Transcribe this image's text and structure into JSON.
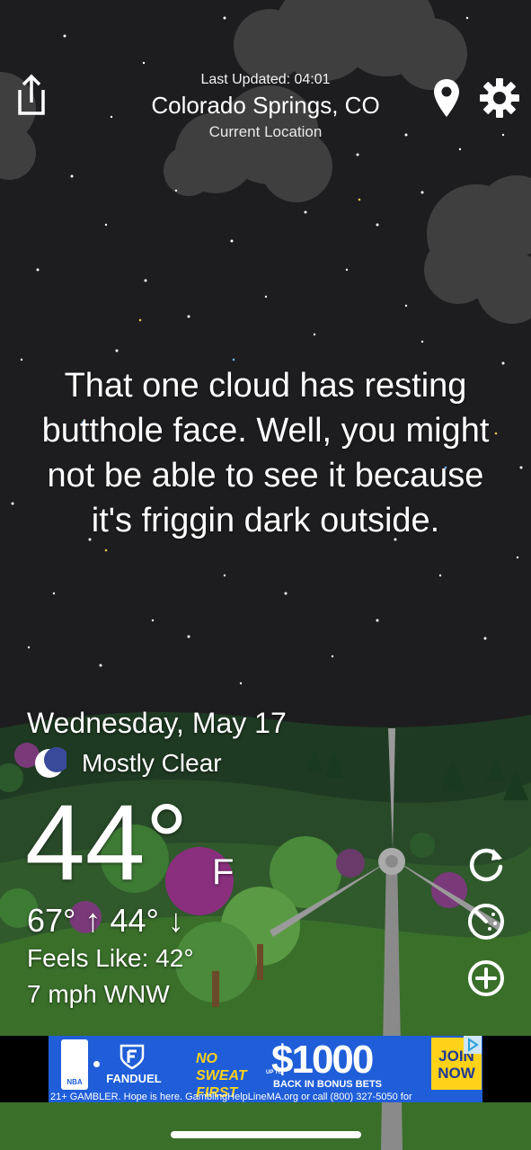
{
  "header": {
    "last_updated": "Last Updated: 04:01",
    "city": "Colorado Springs, CO",
    "subtitle": "Current Location"
  },
  "icons": {
    "share": "share-icon",
    "location": "location-pin-icon",
    "settings": "gear-icon",
    "condition": "crescent-moon-icon",
    "refresh": "refresh-icon",
    "radar": "radar-icon",
    "add": "add-circle-icon"
  },
  "message": "That one cloud has resting butthole face. Well, you might not be able to see it because it's friggin dark outside.",
  "weather": {
    "date": "Wednesday, May 17",
    "condition": "Mostly Clear",
    "temperature": "44°",
    "unit": "F",
    "high_low": "67° ↑  44° ↓",
    "feels_like": "Feels Like: 42°",
    "wind": "7 mph WNW"
  },
  "ad": {
    "nba": "NBA",
    "brand": "FANDUEL",
    "headline": "NO SWEAT FIRST BET",
    "up_to": "UP TO",
    "amount": "$1000",
    "bonus": "BACK IN BONUS BETS",
    "cta": "JOIN NOW",
    "disclaimer": "21+ GAMBLER. Hope is here. GamblingHelpLineMA.org or call (800) 327-5050 for"
  },
  "colors": {
    "night_sky": "#1d1d1f",
    "hill_green": "#3a6f2a",
    "ad_blue": "#1f5ed8",
    "ad_yellow": "#ffd21a"
  }
}
